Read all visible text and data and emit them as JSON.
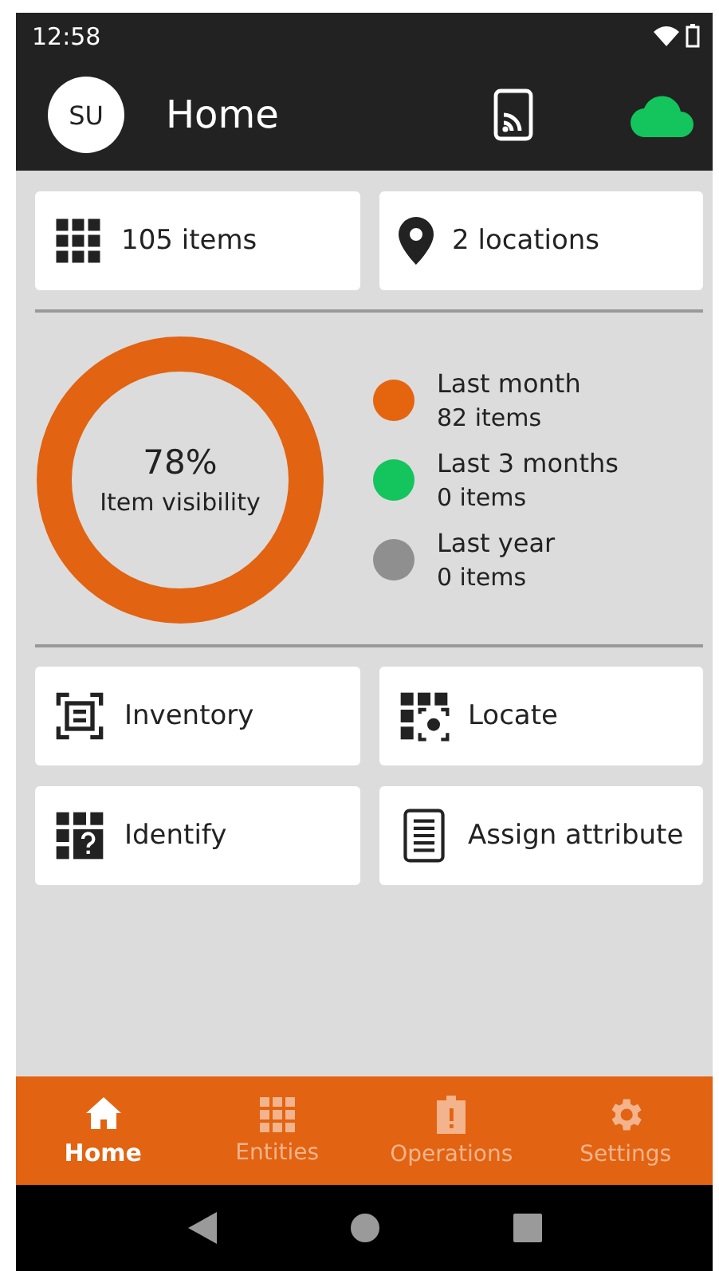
{
  "status_bar": {
    "time": "12:58"
  },
  "app_bar": {
    "avatar": "SU",
    "title": "Home"
  },
  "summary": [
    {
      "kind": "grid",
      "label": "105 items"
    },
    {
      "kind": "pin",
      "label": "2 locations"
    }
  ],
  "visibility": {
    "percent": "78%",
    "label": "Item visibility",
    "legend": [
      {
        "title": "Last month",
        "count": "82 items",
        "color": "#e5650f"
      },
      {
        "title": "Last 3 months",
        "count": "0 items",
        "color": "#14c45c"
      },
      {
        "title": "Last year",
        "count": "0 items",
        "color": "#8f8f8f"
      }
    ]
  },
  "actions": [
    {
      "kind": "inventory",
      "label": "Inventory"
    },
    {
      "kind": "locate",
      "label": "Locate"
    },
    {
      "kind": "identify",
      "label": "Identify"
    },
    {
      "kind": "attribute",
      "label": "Assign attribute"
    }
  ],
  "bottom_nav": [
    {
      "kind": "home",
      "label": "Home",
      "selected": true
    },
    {
      "kind": "grid",
      "label": "Entities",
      "selected": false
    },
    {
      "kind": "clipboard",
      "label": "Operations",
      "selected": false
    },
    {
      "kind": "gear",
      "label": "Settings",
      "selected": false
    }
  ]
}
